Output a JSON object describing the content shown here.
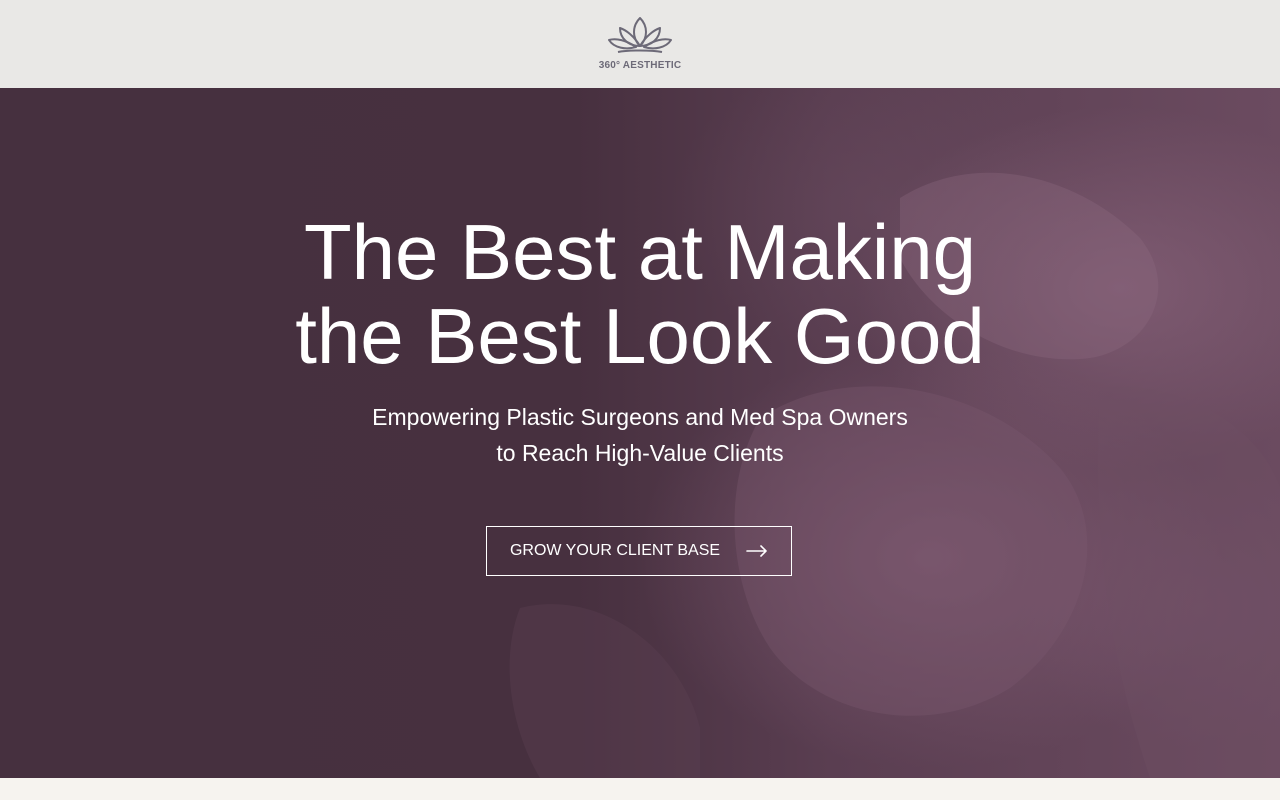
{
  "header": {
    "brand_name": "360° AESTHETIC",
    "logo_icon": "lotus-icon",
    "logo_color": "#6d6a78",
    "background_color": "#e9e8e6"
  },
  "hero": {
    "title_line1": "The Best at Making",
    "title_line2": "the Best Look Good",
    "subtitle_line1": "Empowering Plastic Surgeons and Med Spa Owners",
    "subtitle_line2": "to Reach High-Value Clients",
    "cta_label": "GROW YOUR CLIENT BASE",
    "cta_icon": "arrow-right-icon",
    "overlay_color": "#46303f",
    "text_color": "#ffffff"
  }
}
